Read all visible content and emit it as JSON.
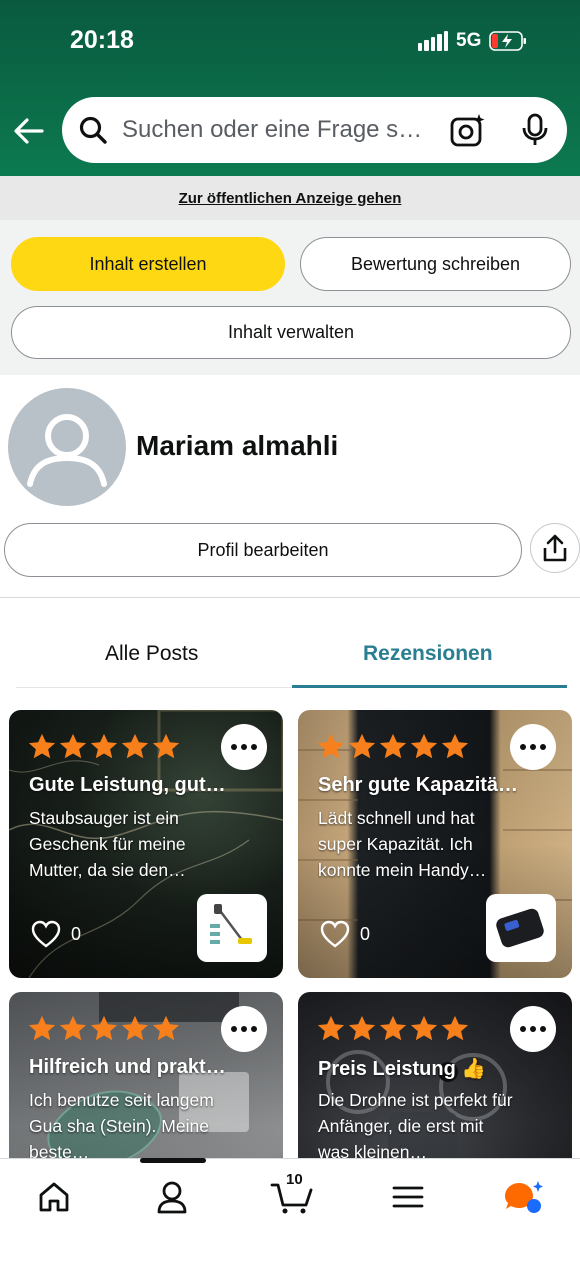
{
  "status_bar": {
    "time": "20:18",
    "network": "5G"
  },
  "search": {
    "placeholder": "Suchen oder eine Frage s…"
  },
  "public_link": "Zur öffentlichen Anzeige gehen",
  "actions": {
    "create_content": "Inhalt erstellen",
    "write_review": "Bewertung schreiben",
    "manage_content": "Inhalt verwalten"
  },
  "profile": {
    "name": "Mariam almahli",
    "edit_label": "Profil bearbeiten"
  },
  "tabs": [
    {
      "label": "Alle Posts",
      "active": false
    },
    {
      "label": "Rezensionen",
      "active": true
    }
  ],
  "reviews": [
    {
      "title": "Gute Leistung, gut…",
      "text": "Staubsauger ist ein Geschenk für meine Mutter, da sie den…",
      "likes": "0",
      "rating": 5
    },
    {
      "title": "Sehr gute Kapazitä…",
      "text": "Lädt schnell und hat super Kapazität. Ich konnte mein Handy…",
      "likes": "0",
      "rating": 5
    },
    {
      "title": "Hilfreich und prakt…",
      "text": "Ich benutze seit langem Gua sha (Stein). Meine beste…",
      "rating": 5
    },
    {
      "title": "Preis Leistung 👍",
      "text": "Die Drohne ist perfekt für Anfänger, die erst mit was kleinen…",
      "rating": 5
    }
  ],
  "bottom_nav": {
    "cart_count": "10",
    "icons": [
      "home-icon",
      "profile-icon",
      "cart-icon",
      "menu-icon",
      "rufus-icon"
    ]
  },
  "colors": {
    "header_green": "#0b6b48",
    "accent_yellow": "#ffd814",
    "tab_active": "#2a7e92",
    "star_orange": "#f77f1c"
  }
}
